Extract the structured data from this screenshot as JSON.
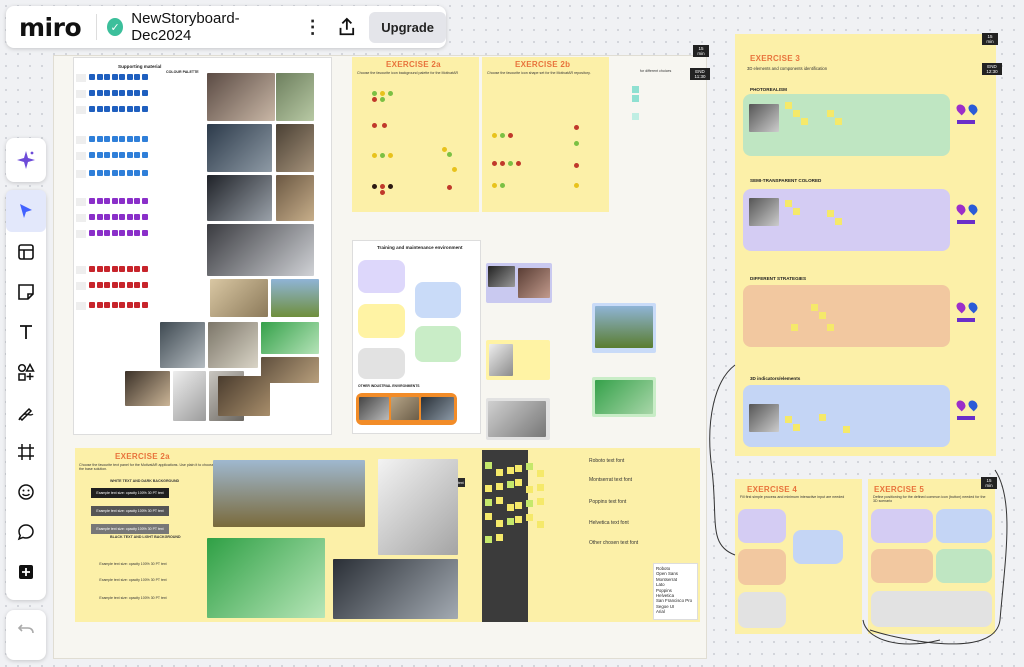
{
  "app": {
    "logo": "miro",
    "board_title": "NewStoryboard-Dec2024",
    "upgrade_label": "Upgrade"
  },
  "toolbar": {
    "tools": [
      "ai-sparkle",
      "select",
      "templates",
      "sticky-note",
      "text",
      "shapes",
      "pen",
      "frame",
      "stickers",
      "comment",
      "more-tools"
    ]
  },
  "colors": {
    "accent": "#4262ff",
    "frame_yellow": "#fcf0a8",
    "title_orange": "#e8733c"
  },
  "supporting": {
    "title": "Supporting material",
    "palette_label": "COLOUR PALETTE"
  },
  "ex2a_top": {
    "title": "EXERCISE 2a",
    "desc": "Choose the favourite icon background palette for the MotivatAR"
  },
  "ex2b": {
    "title": "EXERCISE 2b",
    "desc": "Choose the favourite icon shape set for the MotivatAR repository."
  },
  "note_diff": "for different choices",
  "timers": {
    "t1": "15 min",
    "t2": "END 11:30",
    "t3": "15 min",
    "t4": "END 12:30",
    "t5": "15 min"
  },
  "training": {
    "title": "Training and maintenance environment",
    "other": "OTHER INDUSTRIAL ENVIRONMENTS"
  },
  "ex3": {
    "title": "EXERCISE 3",
    "desc": "3D elements and components identification",
    "sections": [
      "PHOTOREALISM",
      "SEMI-TRANSPARENT COLORED",
      "DIFFERENT STRATEGIES",
      "3D indicators/elements"
    ]
  },
  "ex2c": {
    "title": "EXERCISE 2c",
    "desc": "Choose the favourite text panel for the MotivatAR applications. Use plain it to choose the base solution.",
    "dark_head": "WHITE TEXT AND DARK BACKGROUND",
    "light_head": "BLACK TEXT AND LIGHT BACKGROUND",
    "sample": "Example text size: opacity 100% 30 PT text"
  },
  "fonts": {
    "items": [
      "Roboto text font",
      "Montserrat text font",
      "Poppins text font",
      "Helvetica text font",
      "Other chosen text font"
    ],
    "list": [
      "Roboto",
      "Open Sans",
      "Montserrat",
      "Lato",
      "Poppins",
      "Helvetica",
      "San Francisco Pro",
      "Segoe UI",
      "Arial"
    ]
  },
  "ex4": {
    "title": "EXERCISE 4",
    "desc": "Fill first simple process and minimum interactive input are needed"
  },
  "ex5": {
    "title": "EXERCISE 5",
    "desc": "Define positioning for the defined common icon (button) needed for the 3D scenario"
  }
}
